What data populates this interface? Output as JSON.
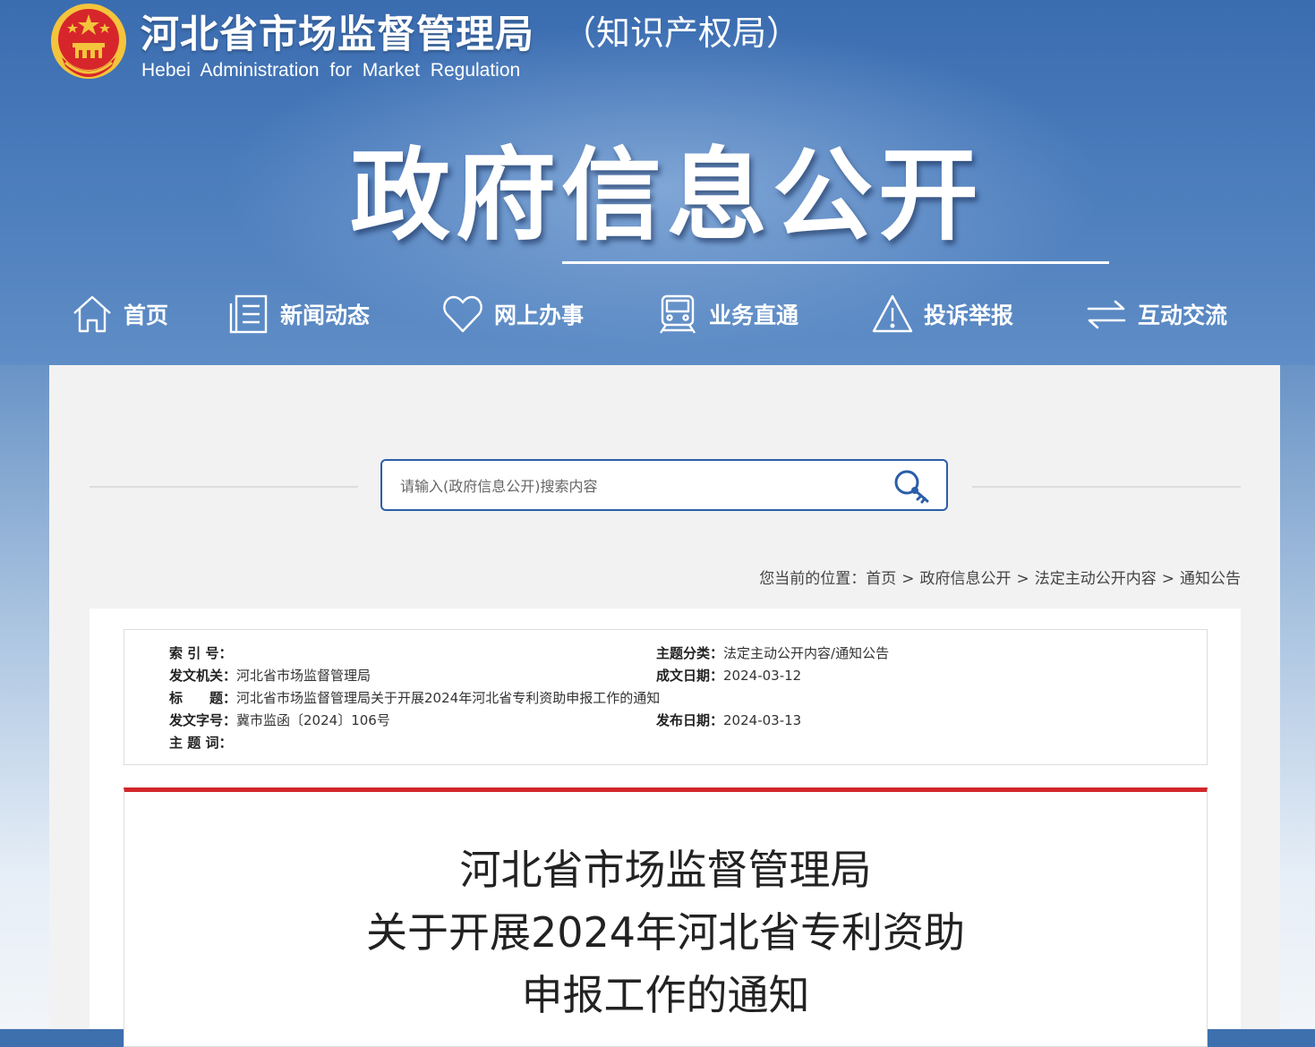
{
  "header": {
    "site_title": "河北省市场监督管理局",
    "site_subtitle": "（知识产权局）",
    "site_title_en": "Hebei Administration for Market Regulation",
    "hero_title": "政府信息公开"
  },
  "nav": {
    "items": [
      {
        "label": "首页",
        "icon": "home-icon"
      },
      {
        "label": "新闻动态",
        "icon": "document-list-icon"
      },
      {
        "label": "网上办事",
        "icon": "heart-icon"
      },
      {
        "label": "业务直通",
        "icon": "train-icon"
      },
      {
        "label": "投诉举报",
        "icon": "warning-icon"
      },
      {
        "label": "互动交流",
        "icon": "exchange-arrows-icon"
      }
    ]
  },
  "search": {
    "placeholder": "请输入(政府信息公开)搜索内容",
    "icon": "key-search-icon"
  },
  "breadcrumb": {
    "prefix": "您当前的位置：",
    "items": [
      "首页",
      "政府信息公开",
      "法定主动公开内容",
      "通知公告"
    ],
    "separator": ">"
  },
  "meta": {
    "index_label": "索 引 号：",
    "index_value": "",
    "category_label": "主题分类：",
    "category_value": "法定主动公开内容/通知公告",
    "issuer_label": "发文机关：",
    "issuer_value": "河北省市场监督管理局",
    "written_date_label": "成文日期：",
    "written_date_value": "2024-03-12",
    "title_label": "标　　题：",
    "title_value": "河北省市场监督管理局关于开展2024年河北省专利资助申报工作的通知",
    "doc_number_label": "发文字号：",
    "doc_number_value": "冀市监函〔2024〕106号",
    "publish_date_label": "发布日期：",
    "publish_date_value": "2024-03-13",
    "keywords_label": "主 题 词：",
    "keywords_value": ""
  },
  "document": {
    "title_lines": [
      "河北省市场监督管理局",
      "关于开展2024年河北省专利资助",
      "申报工作的通知"
    ]
  },
  "colors": {
    "brand_blue": "#2a5ea8",
    "accent_red": "#d2262b",
    "emblem_red": "#d7262b",
    "emblem_gold": "#f3c43c"
  }
}
